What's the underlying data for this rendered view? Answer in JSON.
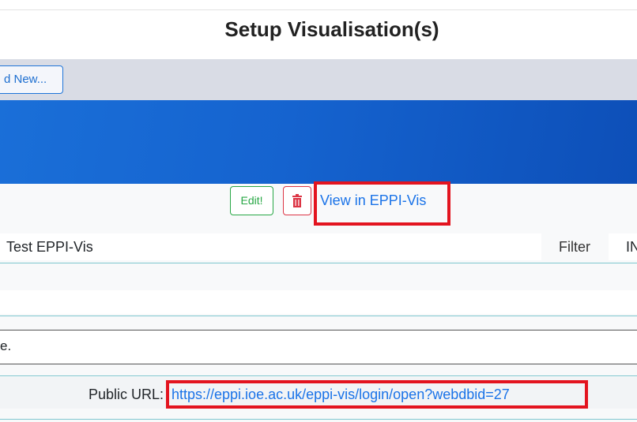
{
  "header": {
    "title": "Setup Visualisation(s)"
  },
  "toolbar": {
    "add_new_label": "d New..."
  },
  "actions": {
    "edit_label": "Edit!",
    "delete_icon": "trash-icon",
    "view_link": "View in EPPI-Vis"
  },
  "visualisation": {
    "name_value": "Test EPPI-Vis",
    "filter_label": "Filter",
    "filter_value": "IN",
    "description_text": "e."
  },
  "public_url": {
    "label": "Public URL:",
    "link": "https://eppi.ioe.ac.uk/eppi-vis/login/open?webdbid=27"
  },
  "colors": {
    "accent_blue": "#1a73e8",
    "highlight_red": "#e3141f",
    "edit_green": "#28a745",
    "delete_red": "#dc3545"
  }
}
